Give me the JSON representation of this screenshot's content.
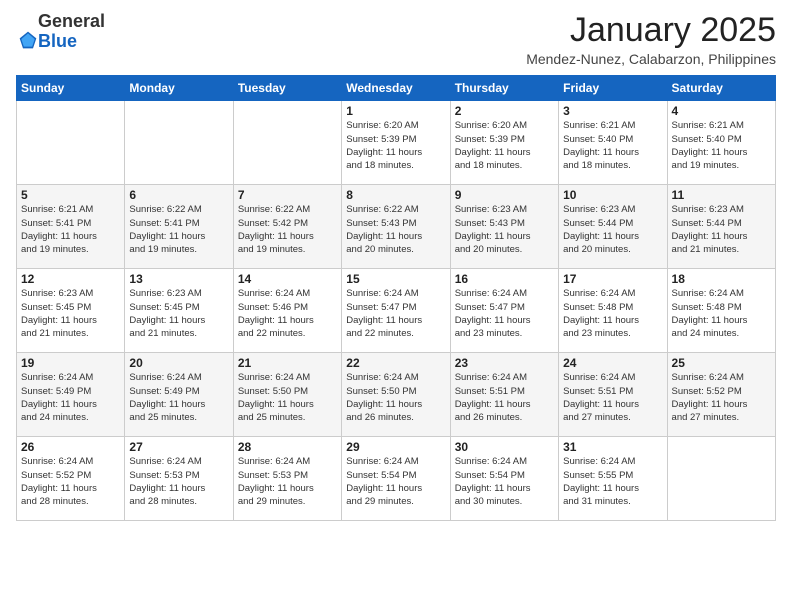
{
  "logo": {
    "general": "General",
    "blue": "Blue"
  },
  "title": "January 2025",
  "subtitle": "Mendez-Nunez, Calabarzon, Philippines",
  "weekdays": [
    "Sunday",
    "Monday",
    "Tuesday",
    "Wednesday",
    "Thursday",
    "Friday",
    "Saturday"
  ],
  "weeks": [
    [
      {
        "day": "",
        "info": ""
      },
      {
        "day": "",
        "info": ""
      },
      {
        "day": "",
        "info": ""
      },
      {
        "day": "1",
        "info": "Sunrise: 6:20 AM\nSunset: 5:39 PM\nDaylight: 11 hours\nand 18 minutes."
      },
      {
        "day": "2",
        "info": "Sunrise: 6:20 AM\nSunset: 5:39 PM\nDaylight: 11 hours\nand 18 minutes."
      },
      {
        "day": "3",
        "info": "Sunrise: 6:21 AM\nSunset: 5:40 PM\nDaylight: 11 hours\nand 18 minutes."
      },
      {
        "day": "4",
        "info": "Sunrise: 6:21 AM\nSunset: 5:40 PM\nDaylight: 11 hours\nand 19 minutes."
      }
    ],
    [
      {
        "day": "5",
        "info": "Sunrise: 6:21 AM\nSunset: 5:41 PM\nDaylight: 11 hours\nand 19 minutes."
      },
      {
        "day": "6",
        "info": "Sunrise: 6:22 AM\nSunset: 5:41 PM\nDaylight: 11 hours\nand 19 minutes."
      },
      {
        "day": "7",
        "info": "Sunrise: 6:22 AM\nSunset: 5:42 PM\nDaylight: 11 hours\nand 19 minutes."
      },
      {
        "day": "8",
        "info": "Sunrise: 6:22 AM\nSunset: 5:43 PM\nDaylight: 11 hours\nand 20 minutes."
      },
      {
        "day": "9",
        "info": "Sunrise: 6:23 AM\nSunset: 5:43 PM\nDaylight: 11 hours\nand 20 minutes."
      },
      {
        "day": "10",
        "info": "Sunrise: 6:23 AM\nSunset: 5:44 PM\nDaylight: 11 hours\nand 20 minutes."
      },
      {
        "day": "11",
        "info": "Sunrise: 6:23 AM\nSunset: 5:44 PM\nDaylight: 11 hours\nand 21 minutes."
      }
    ],
    [
      {
        "day": "12",
        "info": "Sunrise: 6:23 AM\nSunset: 5:45 PM\nDaylight: 11 hours\nand 21 minutes."
      },
      {
        "day": "13",
        "info": "Sunrise: 6:23 AM\nSunset: 5:45 PM\nDaylight: 11 hours\nand 21 minutes."
      },
      {
        "day": "14",
        "info": "Sunrise: 6:24 AM\nSunset: 5:46 PM\nDaylight: 11 hours\nand 22 minutes."
      },
      {
        "day": "15",
        "info": "Sunrise: 6:24 AM\nSunset: 5:47 PM\nDaylight: 11 hours\nand 22 minutes."
      },
      {
        "day": "16",
        "info": "Sunrise: 6:24 AM\nSunset: 5:47 PM\nDaylight: 11 hours\nand 23 minutes."
      },
      {
        "day": "17",
        "info": "Sunrise: 6:24 AM\nSunset: 5:48 PM\nDaylight: 11 hours\nand 23 minutes."
      },
      {
        "day": "18",
        "info": "Sunrise: 6:24 AM\nSunset: 5:48 PM\nDaylight: 11 hours\nand 24 minutes."
      }
    ],
    [
      {
        "day": "19",
        "info": "Sunrise: 6:24 AM\nSunset: 5:49 PM\nDaylight: 11 hours\nand 24 minutes."
      },
      {
        "day": "20",
        "info": "Sunrise: 6:24 AM\nSunset: 5:49 PM\nDaylight: 11 hours\nand 25 minutes."
      },
      {
        "day": "21",
        "info": "Sunrise: 6:24 AM\nSunset: 5:50 PM\nDaylight: 11 hours\nand 25 minutes."
      },
      {
        "day": "22",
        "info": "Sunrise: 6:24 AM\nSunset: 5:50 PM\nDaylight: 11 hours\nand 26 minutes."
      },
      {
        "day": "23",
        "info": "Sunrise: 6:24 AM\nSunset: 5:51 PM\nDaylight: 11 hours\nand 26 minutes."
      },
      {
        "day": "24",
        "info": "Sunrise: 6:24 AM\nSunset: 5:51 PM\nDaylight: 11 hours\nand 27 minutes."
      },
      {
        "day": "25",
        "info": "Sunrise: 6:24 AM\nSunset: 5:52 PM\nDaylight: 11 hours\nand 27 minutes."
      }
    ],
    [
      {
        "day": "26",
        "info": "Sunrise: 6:24 AM\nSunset: 5:52 PM\nDaylight: 11 hours\nand 28 minutes."
      },
      {
        "day": "27",
        "info": "Sunrise: 6:24 AM\nSunset: 5:53 PM\nDaylight: 11 hours\nand 28 minutes."
      },
      {
        "day": "28",
        "info": "Sunrise: 6:24 AM\nSunset: 5:53 PM\nDaylight: 11 hours\nand 29 minutes."
      },
      {
        "day": "29",
        "info": "Sunrise: 6:24 AM\nSunset: 5:54 PM\nDaylight: 11 hours\nand 29 minutes."
      },
      {
        "day": "30",
        "info": "Sunrise: 6:24 AM\nSunset: 5:54 PM\nDaylight: 11 hours\nand 30 minutes."
      },
      {
        "day": "31",
        "info": "Sunrise: 6:24 AM\nSunset: 5:55 PM\nDaylight: 11 hours\nand 31 minutes."
      },
      {
        "day": "",
        "info": ""
      }
    ]
  ]
}
